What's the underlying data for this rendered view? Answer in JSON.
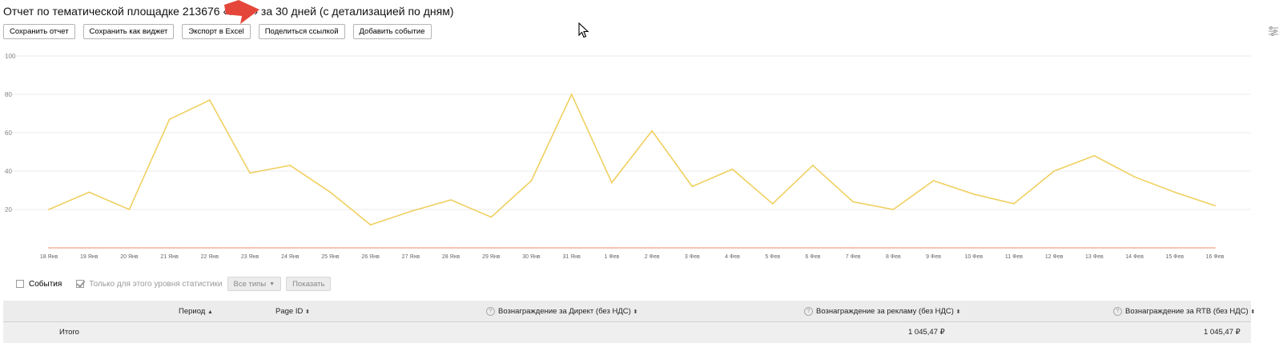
{
  "header": {
    "title_pre": "Отчет по тематической площадке 213676 «",
    "title_post": "rs.ru» за 30 дней (с детализацией по дням)"
  },
  "toolbar": {
    "buttons": [
      "Сохранить отчет",
      "Сохранить как виджет",
      "Экспорт в Excel",
      "Поделиться ссылкой",
      "Добавить событие"
    ]
  },
  "chart_data": {
    "type": "line",
    "x": [
      "18 Янв",
      "19 Янв",
      "20 Янв",
      "21 Янв",
      "22 Янв",
      "23 Янв",
      "24 Янв",
      "25 Янв",
      "26 Янв",
      "27 Янв",
      "28 Янв",
      "29 Янв",
      "30 Янв",
      "31 Янв",
      "1 Фев",
      "2 Фев",
      "3 Фев",
      "4 Фев",
      "5 Фев",
      "6 Фев",
      "7 Фев",
      "8 Фев",
      "9 Фев",
      "10 Фев",
      "11 Фев",
      "12 Фев",
      "13 Фев",
      "14 Фев",
      "15 Фев",
      "16 Фев"
    ],
    "series": [
      {
        "color": "#f0d060",
        "values": [
          20,
          29,
          20,
          67,
          77,
          39,
          43,
          29,
          12,
          19,
          25,
          16,
          35,
          80,
          34,
          61,
          32,
          41,
          23,
          43,
          24,
          20,
          35,
          28,
          23,
          40,
          48,
          37,
          29,
          22
        ]
      },
      {
        "color": "#f4b09a",
        "values": [
          0,
          0,
          0,
          0,
          0,
          0,
          0,
          0,
          0,
          0,
          0,
          0,
          0,
          0,
          0,
          0,
          0,
          0,
          0,
          0,
          0,
          0,
          0,
          0,
          0,
          0,
          0,
          0,
          0,
          0
        ]
      }
    ],
    "yticks": [
      "20",
      "40",
      "60",
      "80",
      "100"
    ],
    "ylim": [
      0,
      100
    ],
    "grid": true
  },
  "filters": {
    "events_label": "События",
    "only_level_label": "Только для этого уровня статистики",
    "all_types_label": "Все типы",
    "show_label": "Показать"
  },
  "table": {
    "headers": {
      "period": "Период",
      "page_id": "Page ID",
      "direct": "Вознаграждение за Директ (без НДС)",
      "ads": "Вознаграждение за рекламу (без НДС)",
      "rtb": "Вознаграждение за RTB (без НДС)"
    },
    "total_row": {
      "label": "Итого",
      "ads": "1 045,47 ₽",
      "rtb": "1 045,47 ₽"
    }
  },
  "icons": {
    "settings": "sliders-icon",
    "question": "?"
  }
}
